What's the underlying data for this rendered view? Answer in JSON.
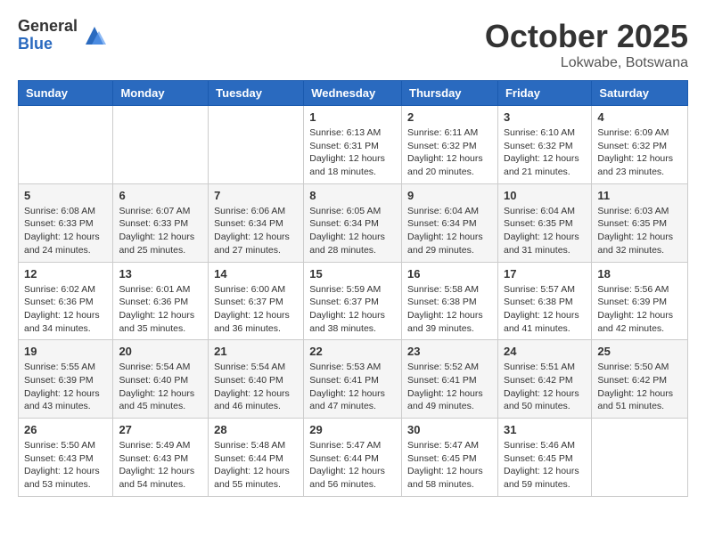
{
  "header": {
    "logo_general": "General",
    "logo_blue": "Blue",
    "month_title": "October 2025",
    "location": "Lokwabe, Botswana"
  },
  "days_of_week": [
    "Sunday",
    "Monday",
    "Tuesday",
    "Wednesday",
    "Thursday",
    "Friday",
    "Saturday"
  ],
  "weeks": [
    [
      {
        "day": "",
        "info": ""
      },
      {
        "day": "",
        "info": ""
      },
      {
        "day": "",
        "info": ""
      },
      {
        "day": "1",
        "info": "Sunrise: 6:13 AM\nSunset: 6:31 PM\nDaylight: 12 hours\nand 18 minutes."
      },
      {
        "day": "2",
        "info": "Sunrise: 6:11 AM\nSunset: 6:32 PM\nDaylight: 12 hours\nand 20 minutes."
      },
      {
        "day": "3",
        "info": "Sunrise: 6:10 AM\nSunset: 6:32 PM\nDaylight: 12 hours\nand 21 minutes."
      },
      {
        "day": "4",
        "info": "Sunrise: 6:09 AM\nSunset: 6:32 PM\nDaylight: 12 hours\nand 23 minutes."
      }
    ],
    [
      {
        "day": "5",
        "info": "Sunrise: 6:08 AM\nSunset: 6:33 PM\nDaylight: 12 hours\nand 24 minutes."
      },
      {
        "day": "6",
        "info": "Sunrise: 6:07 AM\nSunset: 6:33 PM\nDaylight: 12 hours\nand 25 minutes."
      },
      {
        "day": "7",
        "info": "Sunrise: 6:06 AM\nSunset: 6:34 PM\nDaylight: 12 hours\nand 27 minutes."
      },
      {
        "day": "8",
        "info": "Sunrise: 6:05 AM\nSunset: 6:34 PM\nDaylight: 12 hours\nand 28 minutes."
      },
      {
        "day": "9",
        "info": "Sunrise: 6:04 AM\nSunset: 6:34 PM\nDaylight: 12 hours\nand 29 minutes."
      },
      {
        "day": "10",
        "info": "Sunrise: 6:04 AM\nSunset: 6:35 PM\nDaylight: 12 hours\nand 31 minutes."
      },
      {
        "day": "11",
        "info": "Sunrise: 6:03 AM\nSunset: 6:35 PM\nDaylight: 12 hours\nand 32 minutes."
      }
    ],
    [
      {
        "day": "12",
        "info": "Sunrise: 6:02 AM\nSunset: 6:36 PM\nDaylight: 12 hours\nand 34 minutes."
      },
      {
        "day": "13",
        "info": "Sunrise: 6:01 AM\nSunset: 6:36 PM\nDaylight: 12 hours\nand 35 minutes."
      },
      {
        "day": "14",
        "info": "Sunrise: 6:00 AM\nSunset: 6:37 PM\nDaylight: 12 hours\nand 36 minutes."
      },
      {
        "day": "15",
        "info": "Sunrise: 5:59 AM\nSunset: 6:37 PM\nDaylight: 12 hours\nand 38 minutes."
      },
      {
        "day": "16",
        "info": "Sunrise: 5:58 AM\nSunset: 6:38 PM\nDaylight: 12 hours\nand 39 minutes."
      },
      {
        "day": "17",
        "info": "Sunrise: 5:57 AM\nSunset: 6:38 PM\nDaylight: 12 hours\nand 41 minutes."
      },
      {
        "day": "18",
        "info": "Sunrise: 5:56 AM\nSunset: 6:39 PM\nDaylight: 12 hours\nand 42 minutes."
      }
    ],
    [
      {
        "day": "19",
        "info": "Sunrise: 5:55 AM\nSunset: 6:39 PM\nDaylight: 12 hours\nand 43 minutes."
      },
      {
        "day": "20",
        "info": "Sunrise: 5:54 AM\nSunset: 6:40 PM\nDaylight: 12 hours\nand 45 minutes."
      },
      {
        "day": "21",
        "info": "Sunrise: 5:54 AM\nSunset: 6:40 PM\nDaylight: 12 hours\nand 46 minutes."
      },
      {
        "day": "22",
        "info": "Sunrise: 5:53 AM\nSunset: 6:41 PM\nDaylight: 12 hours\nand 47 minutes."
      },
      {
        "day": "23",
        "info": "Sunrise: 5:52 AM\nSunset: 6:41 PM\nDaylight: 12 hours\nand 49 minutes."
      },
      {
        "day": "24",
        "info": "Sunrise: 5:51 AM\nSunset: 6:42 PM\nDaylight: 12 hours\nand 50 minutes."
      },
      {
        "day": "25",
        "info": "Sunrise: 5:50 AM\nSunset: 6:42 PM\nDaylight: 12 hours\nand 51 minutes."
      }
    ],
    [
      {
        "day": "26",
        "info": "Sunrise: 5:50 AM\nSunset: 6:43 PM\nDaylight: 12 hours\nand 53 minutes."
      },
      {
        "day": "27",
        "info": "Sunrise: 5:49 AM\nSunset: 6:43 PM\nDaylight: 12 hours\nand 54 minutes."
      },
      {
        "day": "28",
        "info": "Sunrise: 5:48 AM\nSunset: 6:44 PM\nDaylight: 12 hours\nand 55 minutes."
      },
      {
        "day": "29",
        "info": "Sunrise: 5:47 AM\nSunset: 6:44 PM\nDaylight: 12 hours\nand 56 minutes."
      },
      {
        "day": "30",
        "info": "Sunrise: 5:47 AM\nSunset: 6:45 PM\nDaylight: 12 hours\nand 58 minutes."
      },
      {
        "day": "31",
        "info": "Sunrise: 5:46 AM\nSunset: 6:45 PM\nDaylight: 12 hours\nand 59 minutes."
      },
      {
        "day": "",
        "info": ""
      }
    ]
  ]
}
